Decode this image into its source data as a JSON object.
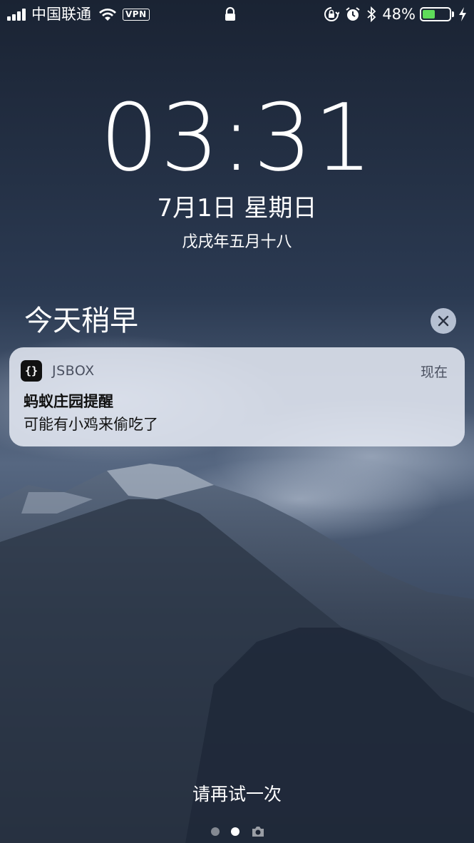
{
  "status_bar": {
    "carrier": "中国联通",
    "vpn_label": "VPN",
    "battery_percent_text": "48%",
    "battery_level": 0.48,
    "icons": [
      "signal-icon",
      "wifi-icon",
      "lock-icon",
      "rotation-lock-icon",
      "alarm-icon",
      "bluetooth-icon",
      "battery-icon",
      "charging-bolt-icon"
    ],
    "battery_fill_color": "#5fdc5a"
  },
  "lock_screen": {
    "time": "03:31",
    "date": "7月1日 星期日",
    "lunar_date": "戊戌年五月十八"
  },
  "notification_center": {
    "section_title": "今天稍早",
    "notification": {
      "app_icon_glyph": "{}",
      "app_name": "JSBOX",
      "time": "现在",
      "title": "蚂蚁庄园提醒",
      "body": "可能有小鸡来偷吃了"
    }
  },
  "bottom": {
    "retry_text": "请再试一次",
    "page_count": 2,
    "active_page": 1,
    "camera_icon": "camera-icon"
  }
}
